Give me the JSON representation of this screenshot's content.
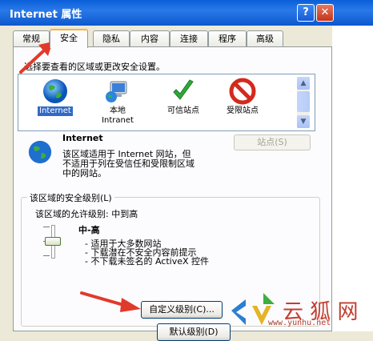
{
  "window": {
    "title": "Internet 属性",
    "help_label": "?",
    "close_label": "✕"
  },
  "tabs": [
    {
      "label": "常规"
    },
    {
      "label": "安全"
    },
    {
      "label": "隐私"
    },
    {
      "label": "内容"
    },
    {
      "label": "连接"
    },
    {
      "label": "程序"
    },
    {
      "label": "高级"
    }
  ],
  "security": {
    "instruction": "选择要查看的区域或更改安全设置。",
    "zones": [
      {
        "label": "Internet",
        "icon": "globe-icon",
        "selected": true
      },
      {
        "label": "本地\nIntranet",
        "icon": "local-intranet-icon",
        "selected": false
      },
      {
        "label": "可信站点",
        "icon": "checkmark-icon",
        "selected": false
      },
      {
        "label": "受限站点",
        "icon": "no-entry-icon",
        "selected": false
      }
    ],
    "zone_title": "Internet",
    "zone_desc_1": "该区域适用于 Internet 网站，但",
    "zone_desc_2": "不适用于列在受信任和受限制区域",
    "zone_desc_3": "中的网站。",
    "sites_button": "站点(S)",
    "group_label": "该区域的安全级别(L)",
    "allowed_levels": "该区域的允许级别: 中到高",
    "level_name": "中-高",
    "bullets": [
      "- 适用于大多数网站",
      "- 下载潜在不安全内容前提示",
      "- 不下载未签名的 ActiveX 控件"
    ],
    "custom_level_button": "自定义级别(C)...",
    "default_level_button_partial": "默认级别(D)"
  },
  "watermark": {
    "text": "云 狐 网",
    "url": "www.yunhu.net"
  },
  "colors": {
    "xp_blue": "#0a5fd8",
    "annotation_red": "#e23a2a",
    "selection": "#316ac5"
  }
}
